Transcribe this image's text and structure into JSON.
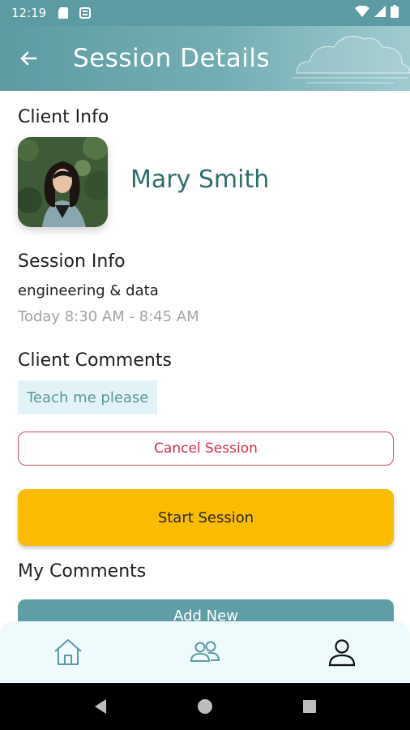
{
  "status_bar": {
    "time": "12:19"
  },
  "app_bar": {
    "title": "Session Details"
  },
  "client_info": {
    "title": "Client Info",
    "name": "Mary Smith"
  },
  "session_info": {
    "title": "Session Info",
    "topic": "engineering & data",
    "time": "Today 8:30 AM - 8:45 AM"
  },
  "client_comments": {
    "title": "Client Comments",
    "comment": "Teach me please"
  },
  "actions": {
    "cancel_label": "Cancel Session",
    "start_label": "Start Session"
  },
  "my_comments": {
    "title": "My Comments",
    "add_label": "Add New"
  },
  "bottom_nav": {
    "items": [
      "home-icon",
      "group-icon",
      "profile-icon"
    ]
  },
  "colors": {
    "accent": "#5d9ba2",
    "start": "#fcbc00",
    "cancel": "#d0304c",
    "name": "#2f6e6b"
  }
}
